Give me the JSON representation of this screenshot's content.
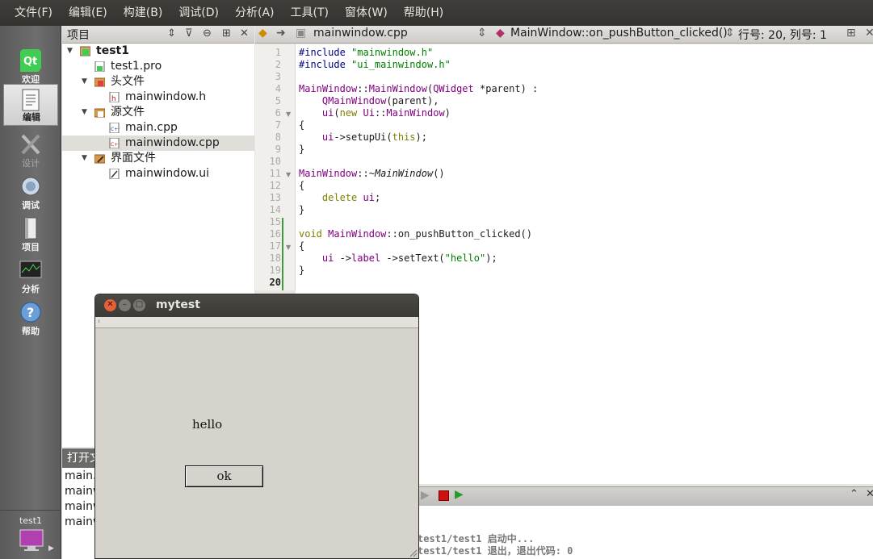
{
  "menu": [
    "文件(F)",
    "编辑(E)",
    "构建(B)",
    "调试(D)",
    "分析(A)",
    "工具(T)",
    "窗体(W)",
    "帮助(H)"
  ],
  "modes": [
    {
      "label": "欢迎",
      "icon": "qt-logo-icon"
    },
    {
      "label": "编辑",
      "icon": "document-edit-icon"
    },
    {
      "label": "设计",
      "icon": "design-tools-icon"
    },
    {
      "label": "调试",
      "icon": "debug-bug-icon"
    },
    {
      "label": "项目",
      "icon": "project-book-icon"
    },
    {
      "label": "分析",
      "icon": "analyze-monitor-icon"
    },
    {
      "label": "帮助",
      "icon": "help-question-icon"
    }
  ],
  "kit": {
    "label": "test1"
  },
  "project_panel": {
    "title": "项目",
    "tree": [
      {
        "label": "test1"
      },
      {
        "label": "test1.pro"
      },
      {
        "label": "头文件"
      },
      {
        "label": "mainwindow.h"
      },
      {
        "label": "源文件"
      },
      {
        "label": "main.cpp"
      },
      {
        "label": "mainwindow.cpp"
      },
      {
        "label": "界面文件"
      },
      {
        "label": "mainwindow.ui"
      }
    ]
  },
  "editor": {
    "file": "mainwindow.cpp",
    "function": "MainWindow::on_pushButton_clicked()",
    "position": "行号: 20, 列号: 1",
    "current_line": 20,
    "line_numbers": [
      "1",
      "2",
      "3",
      "4",
      "5",
      "6",
      "7",
      "8",
      "9",
      "10",
      "11",
      "12",
      "13",
      "14",
      "15",
      "16",
      "17",
      "18",
      "19",
      "20"
    ]
  },
  "open_docs": {
    "title": "打开文",
    "items": [
      "main.c",
      "mainw",
      "mainw",
      "mainw"
    ]
  },
  "output": {
    "lines": [
      "test1/test1 启动中...",
      "test1/test1 退出，退出代码: 0"
    ]
  },
  "app_window": {
    "title": "mytest",
    "menu_glyph": "ᵢ",
    "label_text": "hello",
    "button_text": "ok"
  }
}
